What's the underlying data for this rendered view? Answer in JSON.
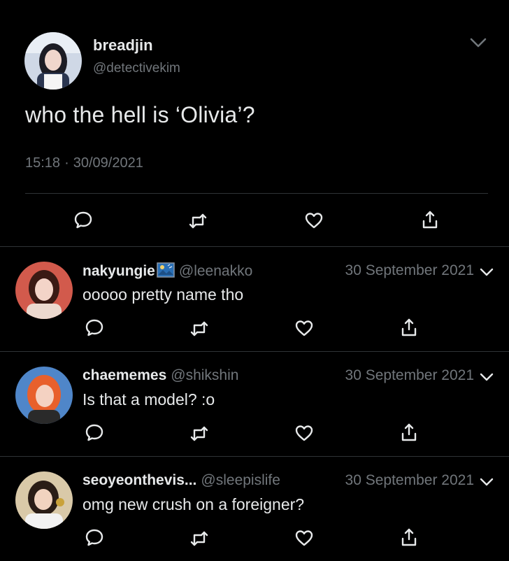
{
  "main_tweet": {
    "name": "breadjin",
    "handle": "@detectivekim",
    "text": "who the hell is ‘Olivia’?",
    "time": "15:18",
    "date": "30/09/2021",
    "icons": [
      "reply-icon",
      "retweet-icon",
      "like-icon",
      "share-icon"
    ]
  },
  "replies": [
    {
      "name": "nakyungie",
      "name_emoji": "painting-emoji",
      "handle": "@leenakko",
      "date": "30 September 2021",
      "text": "ooooo pretty name tho"
    },
    {
      "name": "chaememes",
      "handle": "@shikshin",
      "date": "30 September 2021",
      "text": "Is that a model? :o"
    },
    {
      "name": "seoyeonthevis...",
      "handle": "@sleepislife",
      "date": "30 September 2021",
      "text": "omg new crush on a foreigner?"
    }
  ],
  "colors": {
    "background": "#000000",
    "text": "#e7e9ea",
    "secondary": "#71767b",
    "divider": "#2f3336"
  }
}
